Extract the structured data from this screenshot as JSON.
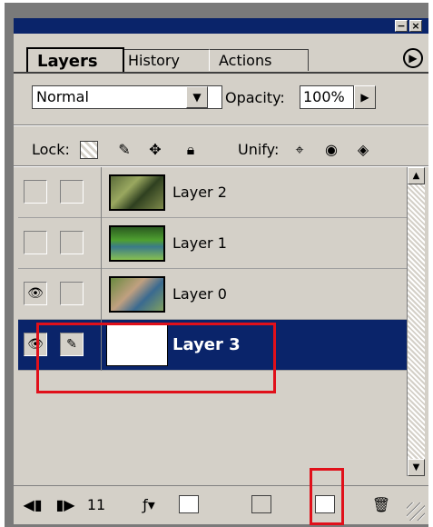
{
  "tabs": [
    "Layers",
    "History",
    "Actions"
  ],
  "blend_mode": "Normal",
  "opacity": {
    "label": "Opacity:",
    "value": "100%"
  },
  "lock_label": "Lock:",
  "unify_label": "Unify:",
  "layers": [
    {
      "name": "Layer 2",
      "visible": false,
      "brush": false,
      "selected": false
    },
    {
      "name": "Layer 1",
      "visible": false,
      "brush": false,
      "selected": false
    },
    {
      "name": "Layer 0",
      "visible": true,
      "brush": false,
      "selected": false
    },
    {
      "name": "Layer 3",
      "visible": true,
      "brush": true,
      "selected": true
    }
  ],
  "bottom": {
    "frame_count": "11"
  },
  "colors": {
    "selection": "#0a246a",
    "highlight": "#e0101a",
    "panel": "#d4d0c8"
  }
}
